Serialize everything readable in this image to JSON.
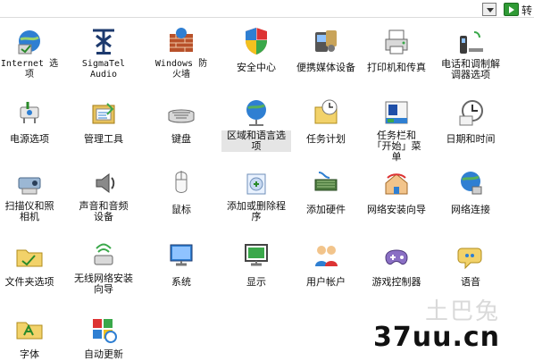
{
  "toolbar": {
    "go_label": "转",
    "dropdown_icon": "dropdown-arrow-icon",
    "go_icon": "go-arrow-icon"
  },
  "items": [
    {
      "label": "Internet 选项",
      "icon": "internet-options-icon"
    },
    {
      "label": "SigmaTel Audio",
      "icon": "sigmatel-audio-icon"
    },
    {
      "label": "Windows 防火墙",
      "icon": "windows-firewall-icon"
    },
    {
      "label": "安全中心",
      "icon": "security-center-shield-icon"
    },
    {
      "label": "便携媒体设备",
      "icon": "portable-media-devices-icon"
    },
    {
      "label": "打印机和传真",
      "icon": "printers-faxes-icon"
    },
    {
      "label": "电话和调制解调器选项",
      "icon": "phone-modem-icon"
    },
    {
      "label": "电源选项",
      "icon": "power-options-icon"
    },
    {
      "label": "管理工具",
      "icon": "admin-tools-icon"
    },
    {
      "label": "键盘",
      "icon": "keyboard-icon"
    },
    {
      "label": "区域和语言选项",
      "icon": "region-language-globe-icon"
    },
    {
      "label": "任务计划",
      "icon": "scheduled-tasks-icon"
    },
    {
      "label": "任务栏和「开始」菜单",
      "icon": "taskbar-start-menu-icon"
    },
    {
      "label": "日期和时间",
      "icon": "date-time-clock-icon"
    },
    {
      "label": "扫描仪和照相机",
      "icon": "scanners-cameras-icon"
    },
    {
      "label": "声音和音频设备",
      "icon": "sounds-audio-speaker-icon"
    },
    {
      "label": "鼠标",
      "icon": "mouse-icon"
    },
    {
      "label": "添加或删除程序",
      "icon": "add-remove-programs-icon"
    },
    {
      "label": "添加硬件",
      "icon": "add-hardware-icon"
    },
    {
      "label": "网络安装向导",
      "icon": "network-setup-wizard-icon"
    },
    {
      "label": "网络连接",
      "icon": "network-connections-icon"
    },
    {
      "label": "文件夹选项",
      "icon": "folder-options-icon"
    },
    {
      "label": "无线网络安装向导",
      "icon": "wireless-network-wizard-icon"
    },
    {
      "label": "系统",
      "icon": "system-icon"
    },
    {
      "label": "显示",
      "icon": "display-icon"
    },
    {
      "label": "用户帐户",
      "icon": "user-accounts-icon"
    },
    {
      "label": "游戏控制器",
      "icon": "game-controllers-icon"
    },
    {
      "label": "语音",
      "icon": "speech-icon"
    },
    {
      "label": "字体",
      "icon": "fonts-folder-icon"
    },
    {
      "label": "自动更新",
      "icon": "automatic-updates-icon"
    }
  ],
  "selected_item": "区域和语言选项",
  "watermark": {
    "ghost_text": "土巴兔",
    "text": "37uu.cn"
  }
}
